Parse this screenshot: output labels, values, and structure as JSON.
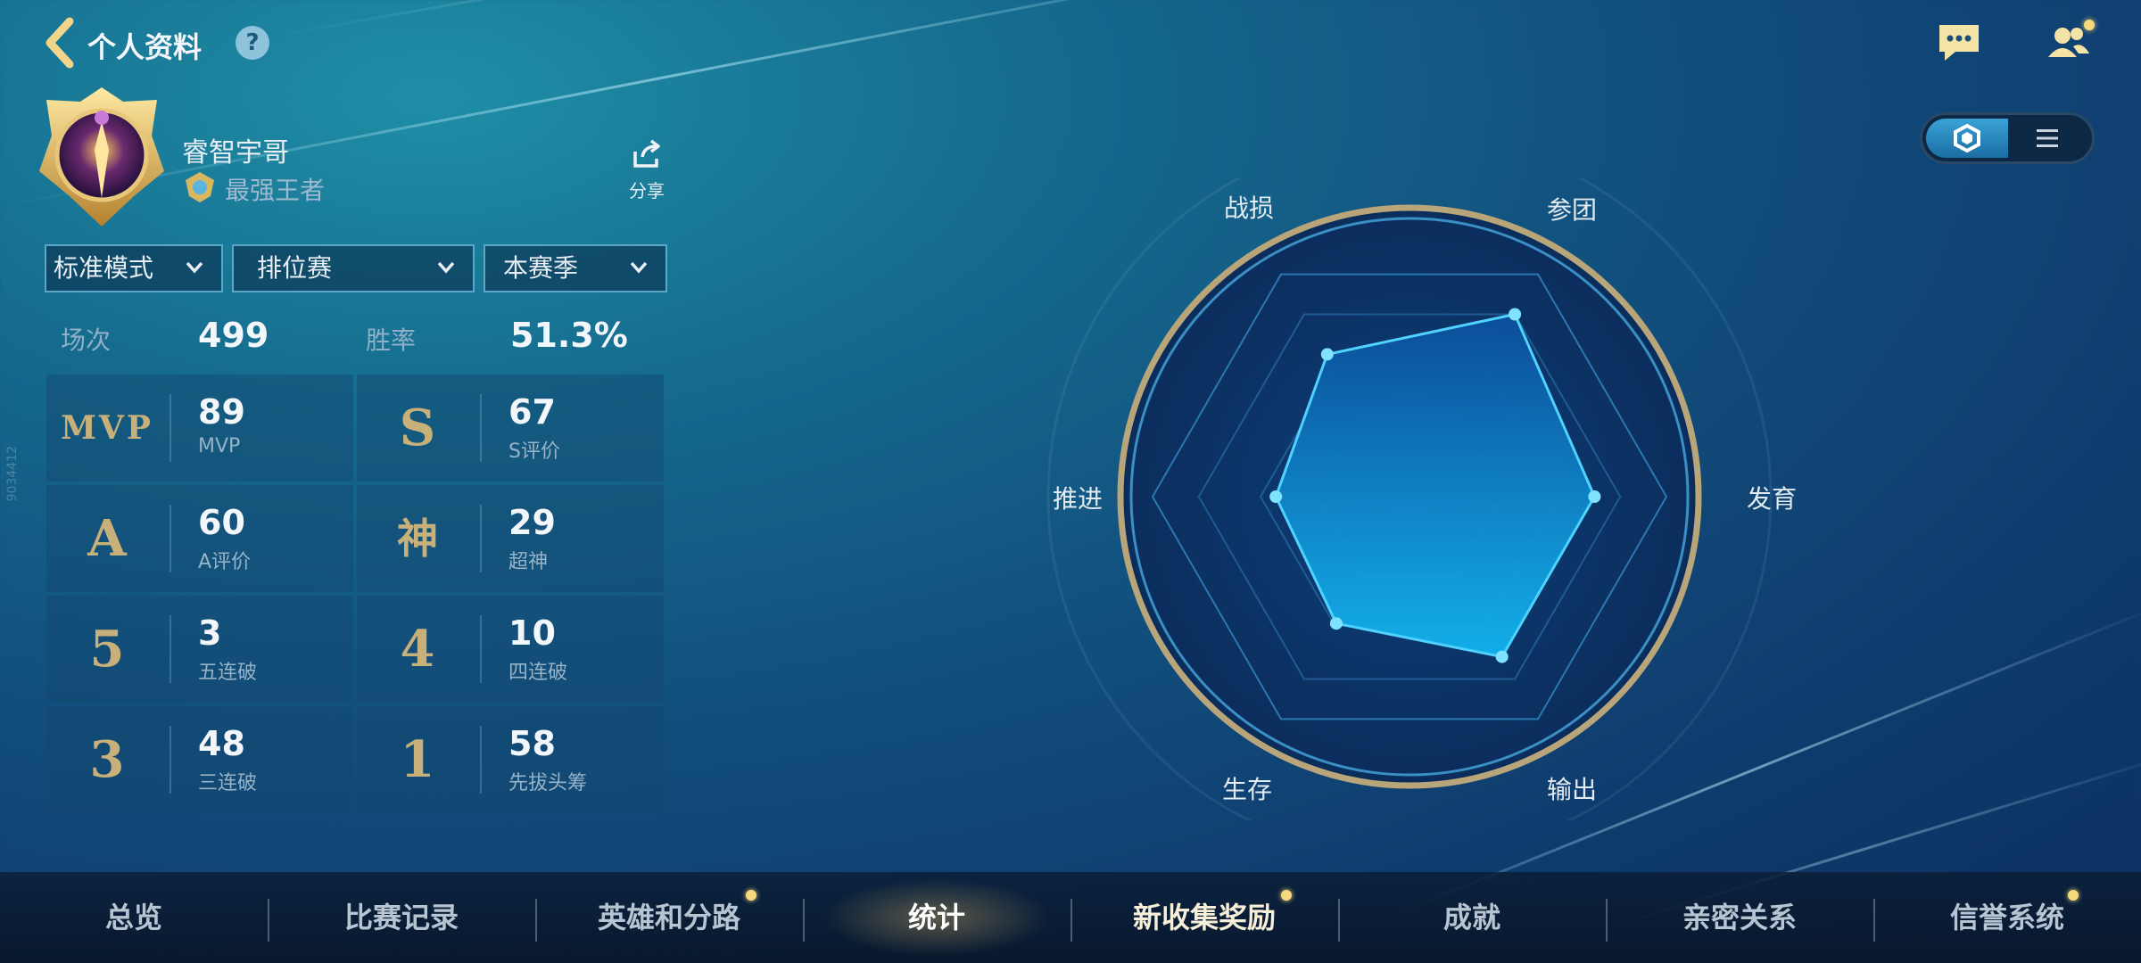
{
  "header": {
    "title": "个人资料",
    "help": "?"
  },
  "profile": {
    "name": "睿智宇哥",
    "rank": "最强王者",
    "share_label": "分享"
  },
  "filters": [
    {
      "label": "标准模式"
    },
    {
      "label": "排位赛"
    },
    {
      "label": "本赛季"
    }
  ],
  "summary": {
    "matches_label": "场次",
    "matches_value": "499",
    "winrate_label": "胜率",
    "winrate_value": "51.3%"
  },
  "stats": [
    {
      "badge": "MVP",
      "value": "89",
      "label": "MVP"
    },
    {
      "badge": "S",
      "value": "67",
      "label": "S评价"
    },
    {
      "badge": "A",
      "value": "60",
      "label": "A评价"
    },
    {
      "badge": "神",
      "value": "29",
      "label": "超神"
    },
    {
      "badge": "5",
      "value": "3",
      "label": "五连破"
    },
    {
      "badge": "4",
      "value": "10",
      "label": "四连破"
    },
    {
      "badge": "3",
      "value": "48",
      "label": "三连破"
    },
    {
      "badge": "1",
      "value": "58",
      "label": "先拔头筹"
    }
  ],
  "side_tag": "9034412",
  "radar": {
    "axes": [
      "参团",
      "发育",
      "输出",
      "生存",
      "推进",
      "战损"
    ],
    "values": [
      0.82,
      0.72,
      0.72,
      0.57,
      0.52,
      0.64
    ]
  },
  "nav": [
    {
      "label": "总览",
      "dot": false
    },
    {
      "label": "比赛记录",
      "dot": false
    },
    {
      "label": "英雄和分路",
      "dot": true
    },
    {
      "label": "统计",
      "dot": false,
      "active": true
    },
    {
      "label": "新收集奖励",
      "dot": true
    },
    {
      "label": "成就",
      "dot": false
    },
    {
      "label": "亲密关系",
      "dot": false
    },
    {
      "label": "信誉系统",
      "dot": true
    }
  ],
  "colors": {
    "accent_gold": "#c8b07a",
    "radar_fill": "#1fa9e8",
    "notify": "#f6d97a"
  }
}
